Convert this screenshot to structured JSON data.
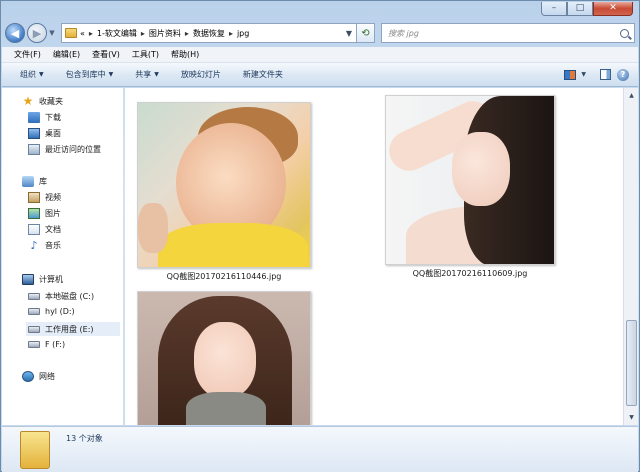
{
  "address": {
    "overflow_marker": "«",
    "crumbs": [
      "1-软文编辑",
      "图片资料",
      "数据恢复",
      "jpg"
    ]
  },
  "search": {
    "placeholder": "搜索 jpg"
  },
  "caption_buttons": {
    "minimize": "–",
    "maximize": "□",
    "close": "✕"
  },
  "menu": [
    "文件(F)",
    "编辑(E)",
    "查看(V)",
    "工具(T)",
    "帮助(H)"
  ],
  "commands": [
    "组织",
    "包含到库中",
    "共享",
    "放映幻灯片",
    "新建文件夹"
  ],
  "nav": {
    "favorites": "收藏夹",
    "downloads": "下载",
    "desktop": "桌面",
    "recent": "最近访问的位置",
    "libraries": "库",
    "videos": "视频",
    "pictures": "图片",
    "documents": "文档",
    "music": "音乐",
    "computer": "计算机",
    "drive_c": "本地磁盘 (C:)",
    "drive_d": "hyl (D:)",
    "drive_e": "工作用盘 (E:)",
    "drive_f": "F (F:)",
    "network": "网络"
  },
  "files": [
    {
      "name": "QQ截图20170216110446.jpg"
    },
    {
      "name": "QQ截图20170216110609.jpg"
    },
    {
      "name": ""
    }
  ],
  "status": {
    "count": "13 个对象"
  }
}
